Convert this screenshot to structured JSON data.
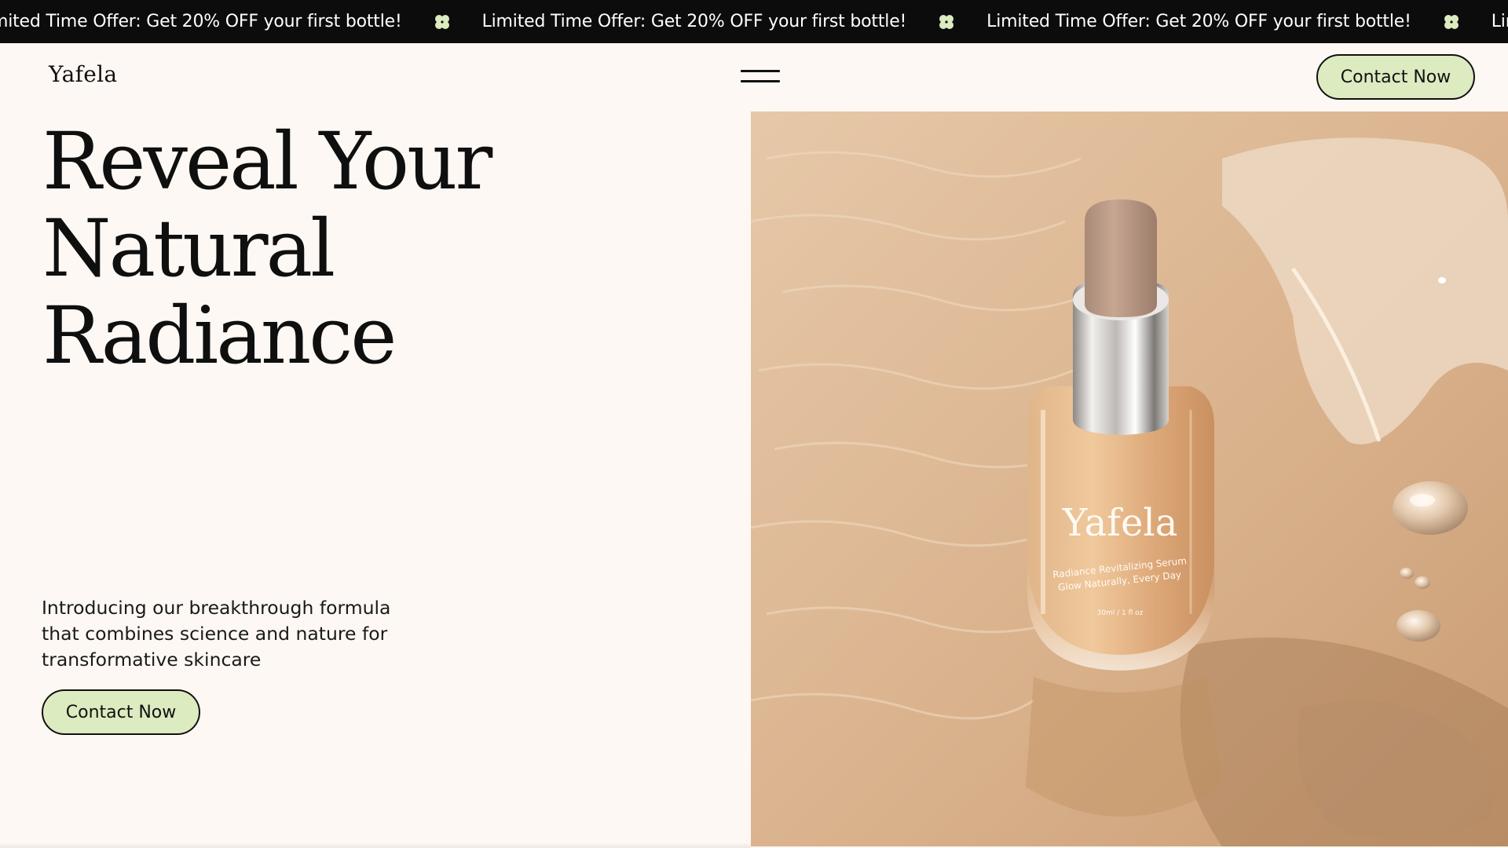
{
  "announcement": {
    "text": "Limited Time Offer: Get 20% OFF your first bottle!",
    "separator_icon": "clover-icon",
    "separator_color": "#dcebc0",
    "background": "#0c0c0c"
  },
  "header": {
    "logo": "Yafela",
    "menu_icon": "hamburger-menu-icon",
    "cta_label": "Contact Now"
  },
  "hero": {
    "headline_lines": [
      "Reveal Your",
      "Natural",
      "Radiance"
    ],
    "description": "Introducing our breakthrough formula that combines science and nature for transformative skincare",
    "cta_label": "Contact Now",
    "product": {
      "brand": "Yafela",
      "line1": "Radiance Revitalizing Serum",
      "line2": "Glow Naturally, Every Day",
      "volume": "30ml / 1 fl oz"
    }
  },
  "colors": {
    "page_background": "#fdf8f3",
    "button_fill": "#dcebc0",
    "text": "#111111",
    "image_tone": "#dcb48e"
  }
}
